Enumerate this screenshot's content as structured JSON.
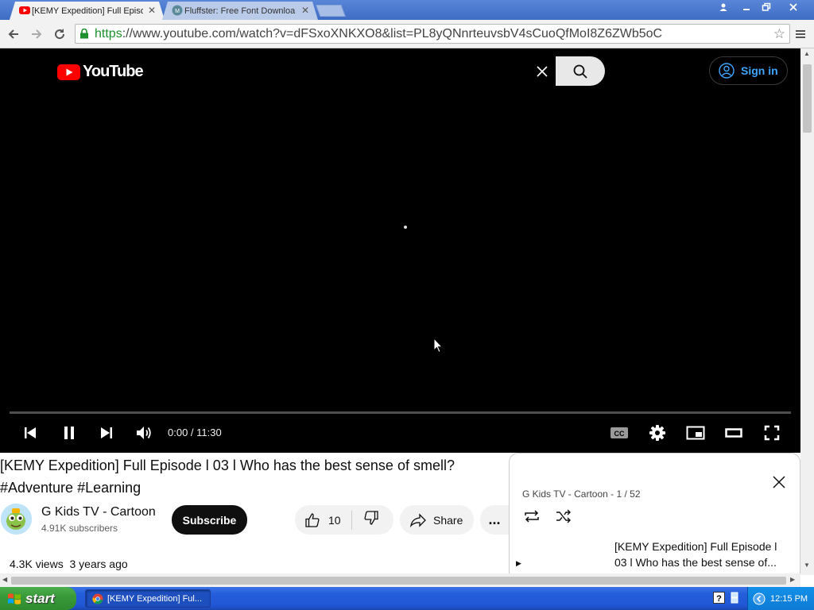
{
  "browser": {
    "tabs": [
      {
        "title": "[KEMY Expedition] Full Episo",
        "active": true
      },
      {
        "title": "Fluffster: Free Font Downloa",
        "active": false
      }
    ],
    "url_scheme": "https",
    "url_rest": "://www.youtube.com/watch?v=dFSxoXNKXO8&list=PL8yQNnrteuvsbV4sCuoQfMoI8Z6ZWb5oC"
  },
  "youtube": {
    "logo_text": "YouTube",
    "sign_in_label": "Sign in"
  },
  "player": {
    "time": "0:00 / 11:30",
    "progress": 0
  },
  "video": {
    "title": "[KEMY Expedition] Full Episode l 03 l Who has the best sense of smell? #Adventure #Learning",
    "channel": "G Kids TV - Cartoon",
    "subscribers": "4.91K subscribers",
    "subscribe_label": "Subscribe",
    "likes": "10",
    "share_label": "Share",
    "more_label": "...",
    "views": "4.3K views",
    "age": "3 years ago"
  },
  "playlist": {
    "meta": "G Kids TV - Cartoon - 1 / 52",
    "items": [
      {
        "title": "[KEMY Expedition] Full Episode l 03 l Who has the best sense of..."
      }
    ]
  },
  "taskbar": {
    "start_label": "start",
    "window_label": "[KEMY Expedition] Ful...",
    "clock": "12:15 PM"
  },
  "colors": {
    "youtube_red": "#ff0000",
    "link_blue": "#3ea6ff",
    "secure_green": "#1e8f2f"
  }
}
